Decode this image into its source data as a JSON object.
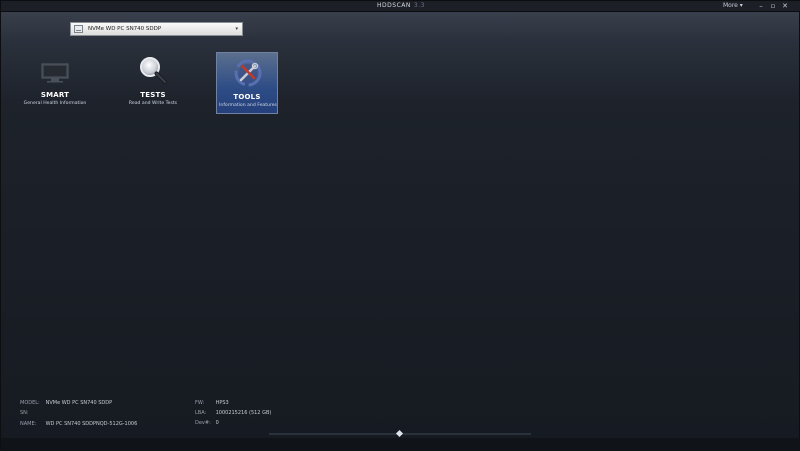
{
  "window": {
    "title": "HDDSCAN",
    "version": "3.3",
    "menu_label": "More ▾",
    "controls": {
      "minimize": "–",
      "maximize": "▫",
      "close": "✕"
    }
  },
  "drive_selector": {
    "selected_value": "NVMe     WD PC SN740 SDDP",
    "arrow": "▾"
  },
  "tools": [
    {
      "title": "SMART",
      "description": "General Health Information",
      "icon": "monitor-icon",
      "selected": false
    },
    {
      "title": "TESTS",
      "description": "Read and Write Tests",
      "icon": "magnifier-icon",
      "selected": false
    },
    {
      "title": "TOOLS",
      "description": "Information and Features",
      "icon": "wrench-icon",
      "selected": true
    }
  ],
  "drive_info": {
    "model_label": "MODEL:",
    "model_value": "NVMe     WD PC SN740 SDDP",
    "sn_label": "SN:",
    "sn_value": "",
    "name_label": "NAME:",
    "name_value": "WD PC SN740 SDDPNQD-512G-1006",
    "fw_label": "FW:",
    "fw_value": "HPS3",
    "lba_label": "LBA:",
    "lba_value": "1000215216  (512 GB)",
    "dev_label": "Dev#:",
    "dev_value": "0"
  },
  "colors": {
    "background": "#161a21",
    "selected_tile": "#2d4c86",
    "text": "#cdd3dc"
  }
}
